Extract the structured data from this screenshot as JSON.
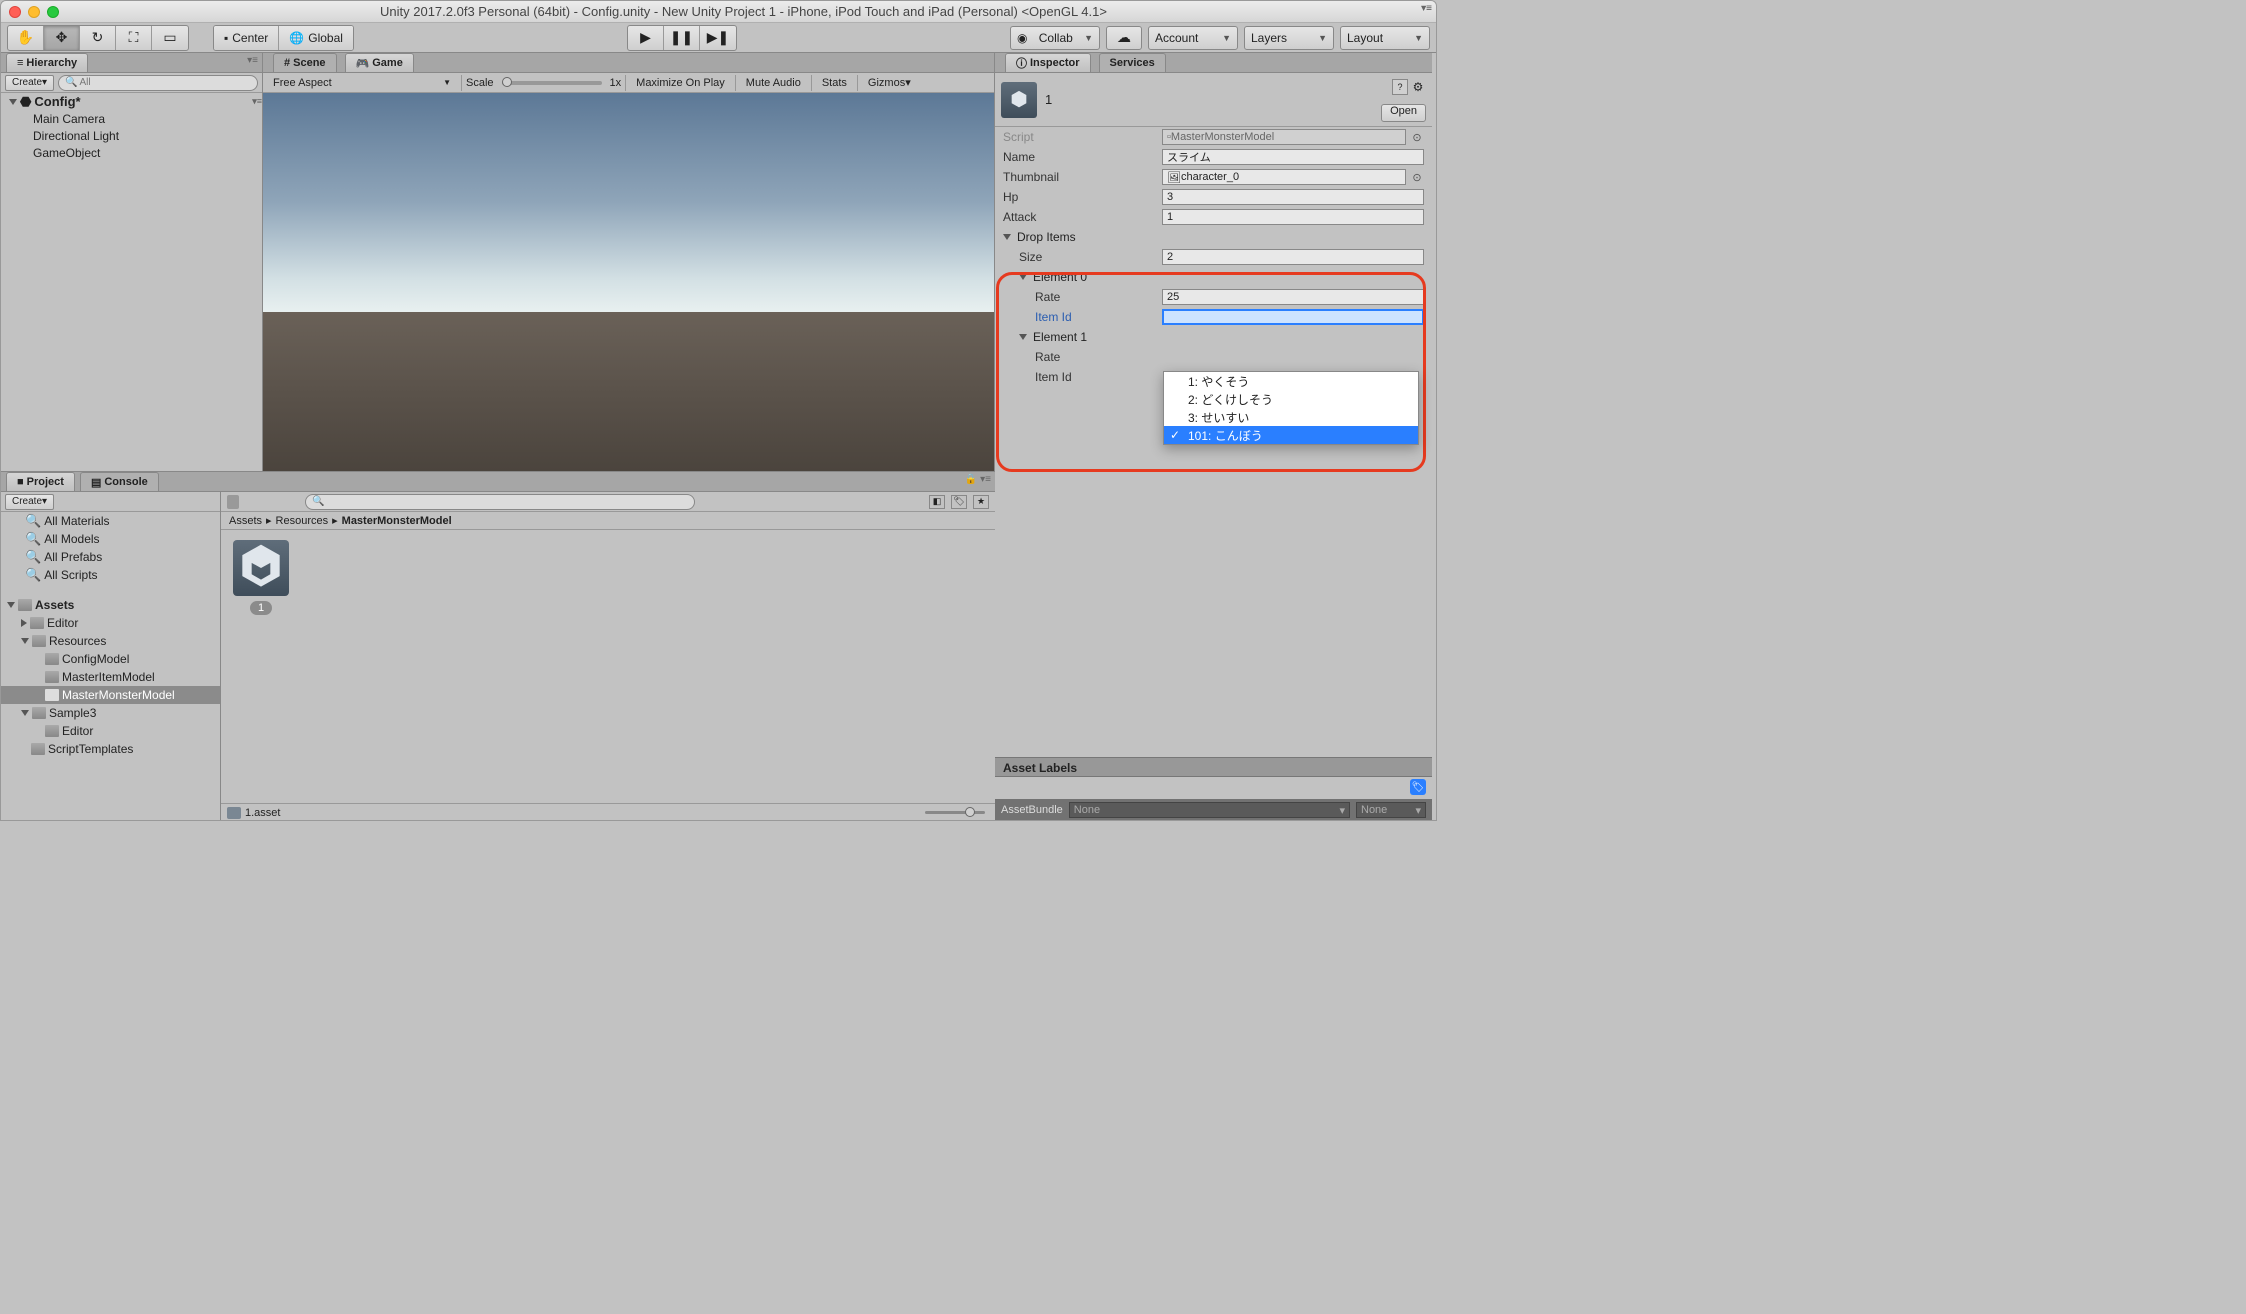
{
  "title": "Unity 2017.2.0f3 Personal (64bit) - Config.unity - New Unity Project 1 - iPhone, iPod Touch and iPad (Personal) <OpenGL 4.1>",
  "toolbar": {
    "center": "Center",
    "global": "Global",
    "collab": "Collab",
    "account": "Account",
    "layers": "Layers",
    "layout": "Layout"
  },
  "hierarchy": {
    "tab": "Hierarchy",
    "create": "Create",
    "search_ph": "All",
    "root": "Config*",
    "items": [
      "Main Camera",
      "Directional Light",
      "GameObject"
    ]
  },
  "scene_tab": "Scene",
  "game_tab": "Game",
  "game_ctrl": {
    "aspect": "Free Aspect",
    "scale": "Scale",
    "scale_val": "1x",
    "maxplay": "Maximize On Play",
    "mute": "Mute Audio",
    "stats": "Stats",
    "gizmos": "Gizmos"
  },
  "project": {
    "tab": "Project",
    "console": "Console",
    "create": "Create",
    "favorites": [
      "All Materials",
      "All Models",
      "All Prefabs",
      "All Scripts"
    ],
    "assets": "Assets",
    "tree": {
      "editor": "Editor",
      "resources": "Resources",
      "configmodel": "ConfigModel",
      "masteritem": "MasterItemModel",
      "mastermonster": "MasterMonsterModel",
      "sample3": "Sample3",
      "editor2": "Editor",
      "scripttemplates": "ScriptTemplates"
    },
    "breadcrumb": [
      "Assets",
      "Resources",
      "MasterMonsterModel"
    ],
    "asset_name": "1",
    "footer": "1.asset"
  },
  "inspector": {
    "tab": "Inspector",
    "services": "Services",
    "obj_name": "1",
    "open": "Open",
    "script_lbl": "Script",
    "script_val": "MasterMonsterModel",
    "name_lbl": "Name",
    "name_val": "スライム",
    "thumb_lbl": "Thumbnail",
    "thumb_val": "character_0",
    "hp_lbl": "Hp",
    "hp_val": "3",
    "attack_lbl": "Attack",
    "attack_val": "1",
    "dropitems": "Drop Items",
    "size_lbl": "Size",
    "size_val": "2",
    "el0": "Element 0",
    "el0_rate_lbl": "Rate",
    "el0_rate_val": "25",
    "el0_item_lbl": "Item Id",
    "el1": "Element 1",
    "el1_rate_lbl": "Rate",
    "el1_item_lbl": "Item Id",
    "dropdown": [
      "1: やくそう",
      "2: どくけしそう",
      "3: せいすい",
      "101: こんぼう"
    ],
    "asset_labels": "Asset Labels",
    "assetbundle": "AssetBundle",
    "none": "None"
  }
}
